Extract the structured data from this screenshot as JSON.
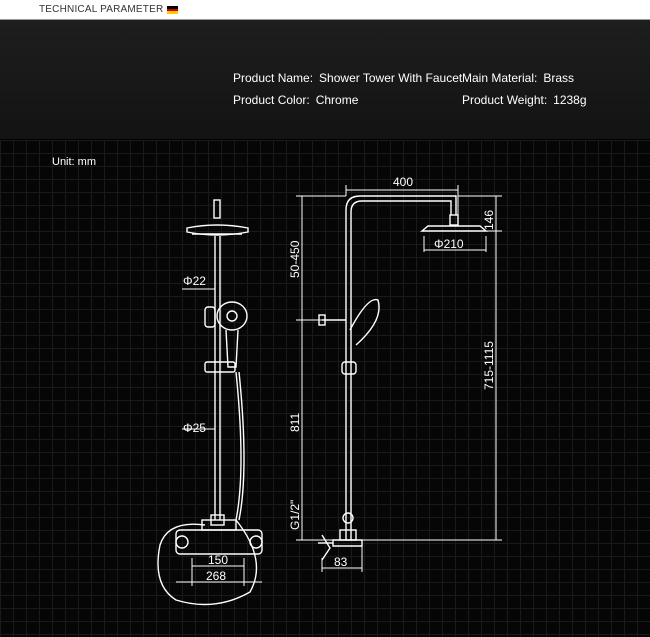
{
  "header": {
    "title": "TECHNICAL PARAMETER",
    "flag_icon": "german-flag-icon"
  },
  "specs": {
    "product_name_label": "Product Name:",
    "product_name_value": "Shower Tower With Faucet",
    "main_material_label": "Main Material:",
    "main_material_value": "Brass",
    "product_color_label": "Product Color:",
    "product_color_value": "Chrome",
    "product_weight_label": "Product Weight:",
    "product_weight_value": "1238g"
  },
  "unit_label": "Unit: mm",
  "dimensions": {
    "pipe_diameter_upper": "Φ22",
    "pipe_diameter_lower": "Φ25",
    "mixer_width": "150",
    "overall_width": "268",
    "arm_length": "400",
    "head_height": "146",
    "head_diameter": "Φ210",
    "slide_range": "50-450",
    "total_height": "715-1115",
    "lower_height": "811",
    "thread": "G1/2\"",
    "wall_offset": "83"
  },
  "colors": {
    "background": "#000000",
    "grid": "#1a1a1a",
    "header_panel": "#1b1b1b",
    "line": "#ffffff"
  }
}
